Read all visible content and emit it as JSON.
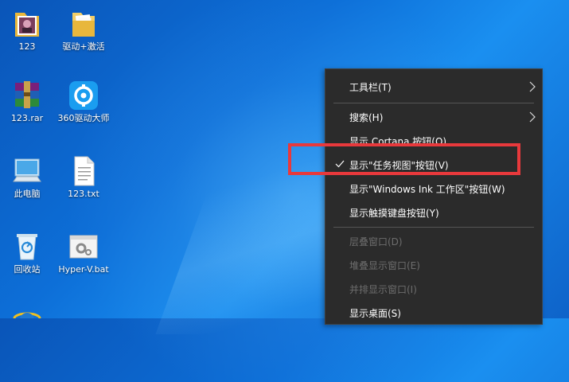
{
  "desktop": {
    "icons": [
      {
        "label": "123"
      },
      {
        "label": "驱动+激活"
      },
      {
        "label": "123.rar"
      },
      {
        "label": "360驱动大师"
      },
      {
        "label": "此电脑"
      },
      {
        "label": "123.txt"
      },
      {
        "label": "回收站"
      },
      {
        "label": "Hyper-V.bat"
      }
    ]
  },
  "context_menu": {
    "items": [
      {
        "label": "工具栏(T)",
        "submenu": true
      },
      {
        "label": "搜索(H)",
        "submenu": true
      },
      {
        "label": "显示 Cortana 按钮(O)"
      },
      {
        "label": "显示\"任务视图\"按钮(V)",
        "checked": true
      },
      {
        "label": "显示\"Windows Ink 工作区\"按钮(W)"
      },
      {
        "label": "显示触摸键盘按钮(Y)"
      },
      {
        "label": "层叠窗口(D)",
        "disabled": true
      },
      {
        "label": "堆叠显示窗口(E)",
        "disabled": true
      },
      {
        "label": "并排显示窗口(I)",
        "disabled": true
      },
      {
        "label": "显示桌面(S)"
      }
    ]
  },
  "colors": {
    "highlight_border": "#e8393c",
    "menu_background": "#2b2b2b"
  }
}
